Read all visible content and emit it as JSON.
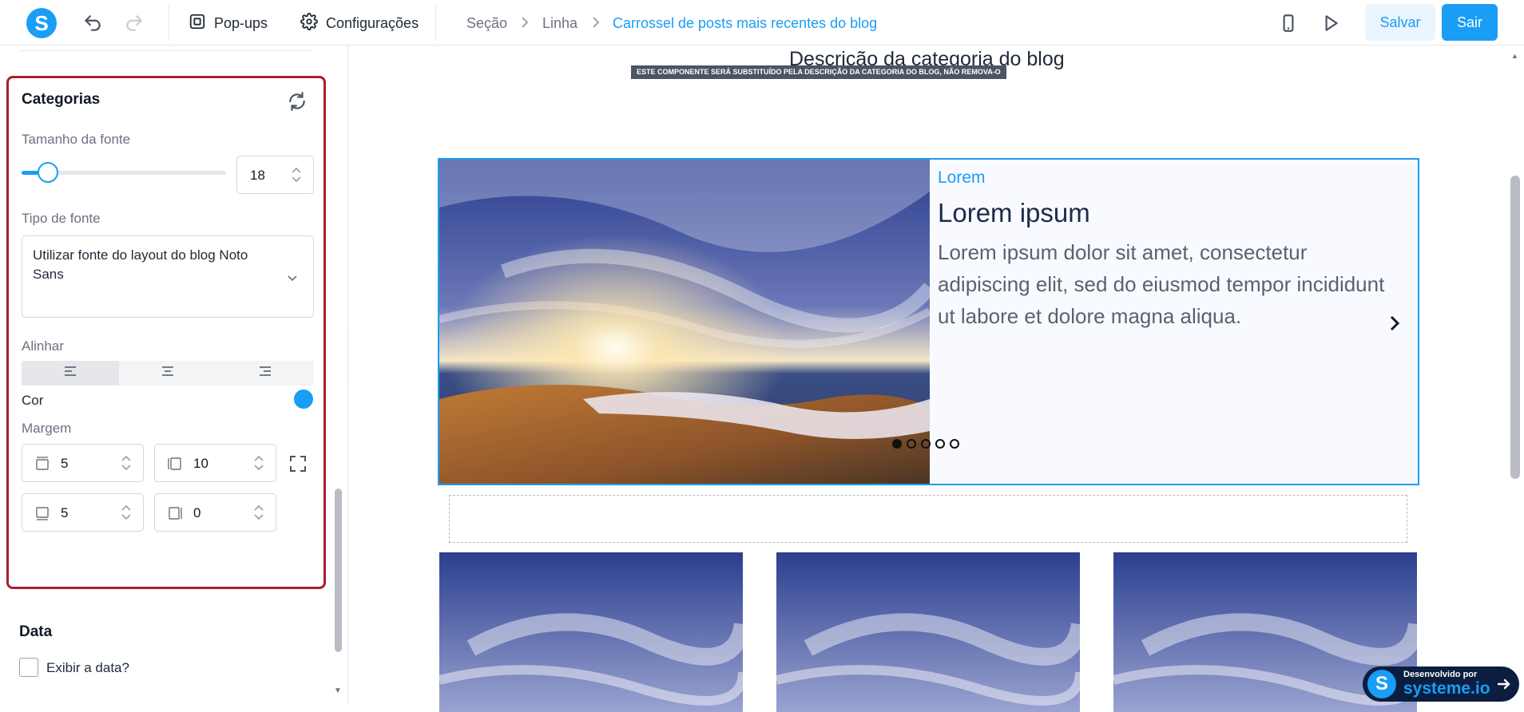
{
  "topbar": {
    "logo_letter": "S",
    "popups_label": "Pop-ups",
    "settings_label": "Configurações",
    "breadcrumbs": [
      "Seção",
      "Linha",
      "Carrossel de posts mais recentes do blog"
    ],
    "save_label": "Salvar",
    "exit_label": "Sair"
  },
  "sidebar": {
    "panel_title": "Categorias",
    "font_size_label": "Tamanho da fonte",
    "font_size_value": "18",
    "font_size_slider_fraction": 0.13,
    "font_type_label": "Tipo de fonte",
    "font_type_value": "Utilizar fonte do layout do blog Noto Sans",
    "align_label": "Alinhar",
    "align_selected": "left",
    "color_label": "Cor",
    "color_value": "#1a9df4",
    "margin_label": "Margem",
    "margin_top": "5",
    "margin_right": "10",
    "margin_bottom": "5",
    "margin_left": "0",
    "date_section_title": "Data",
    "show_date_label": "Exibir a data?",
    "show_date_checked": false
  },
  "canvas": {
    "category_description": "Descrição da categoria do blog",
    "description_note": "ESTE COMPONENTE SERÁ SUBSTITUÍDO PELA DESCRIÇÃO DA CATEGORIA DO BLOG, NÃO REMOVA-O",
    "carousel": {
      "category": "Lorem",
      "title": "Lorem ipsum",
      "text": "Lorem ipsum dolor sit amet, consectetur adipiscing elit, sed do eiusmod tempor incididunt ut labore et dolore magna aliqua.",
      "slide_count": 5,
      "active_slide": 1
    }
  },
  "badge": {
    "small_text": "Desenvolvido por",
    "brand": "systeme.io",
    "logo_letter": "S"
  },
  "colors": {
    "accent": "#1a9df4",
    "panel_border": "#a8202a"
  }
}
